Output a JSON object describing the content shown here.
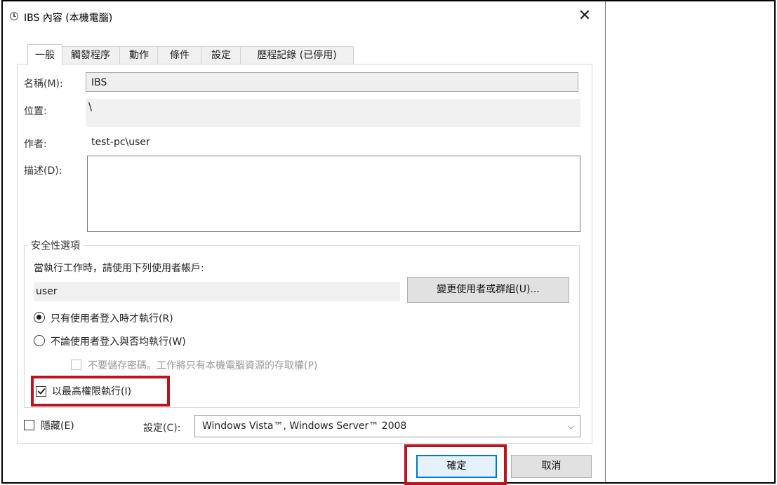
{
  "window": {
    "title": "IBS 內容 (本機電腦)",
    "close_glyph": "✕"
  },
  "tabs": [
    {
      "label": "一般",
      "active": true
    },
    {
      "label": "觸發程序",
      "active": false
    },
    {
      "label": "動作",
      "active": false
    },
    {
      "label": "條件",
      "active": false
    },
    {
      "label": "設定",
      "active": false
    },
    {
      "label": "歷程記錄 (已停用)",
      "active": false
    }
  ],
  "general": {
    "name_label": "名稱(M):",
    "name_value": "IBS",
    "location_label": "位置:",
    "location_value": "\\",
    "author_label": "作者:",
    "author_value": "test-pc\\user",
    "description_label": "描述(D):",
    "description_value": ""
  },
  "security": {
    "group_title": "安全性選項",
    "account_prompt": "當執行工作時，請使用下列使用者帳戶:",
    "account_value": "user",
    "change_button": "變更使用者或群組(U)...",
    "radio_logged_on": {
      "label": "只有使用者登入時才執行(R)",
      "checked": true
    },
    "radio_any": {
      "label": "不論使用者登入與否均執行(W)",
      "checked": false
    },
    "no_store_password": {
      "label": "不要儲存密碼。工作將只有本機電腦資源的存取權(P)",
      "checked": false,
      "enabled": false
    },
    "highest_privileges": {
      "label": "以最高權限執行(I)",
      "checked": true
    }
  },
  "bottom": {
    "hidden_label": "隱藏(E)",
    "hidden_checked": false,
    "configure_label": "設定(C):",
    "configure_value": "Windows Vista™, Windows Server™ 2008"
  },
  "buttons": {
    "ok": "確定",
    "cancel": "取消"
  },
  "colors": {
    "highlight_red": "#b9141f",
    "ok_border": "#0078d7"
  }
}
